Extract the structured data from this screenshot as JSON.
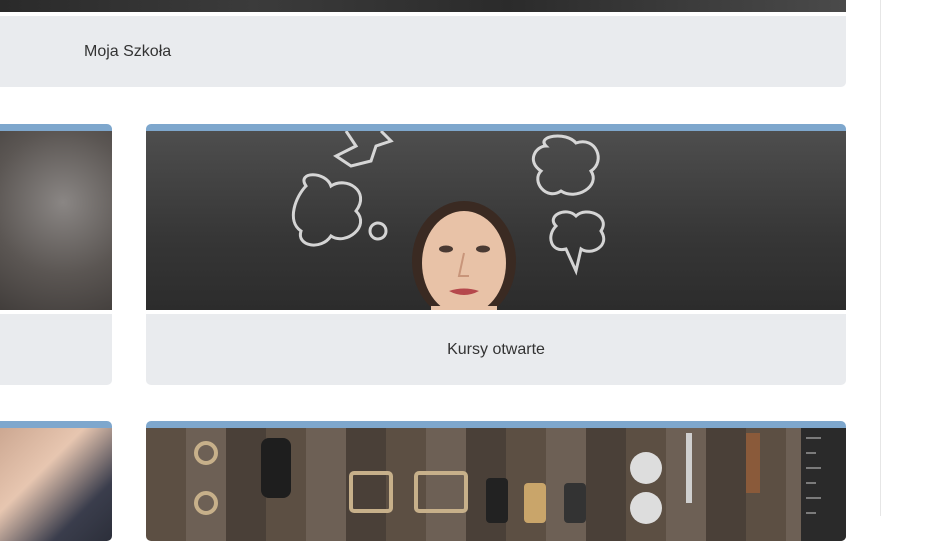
{
  "cards": [
    {
      "id": "top",
      "label": "Moja Szkoła"
    },
    {
      "id": "open",
      "label": "Kursy otwarte"
    }
  ],
  "colors": {
    "accent": "#7ea7cd",
    "caption_bg": "#e9ebee",
    "caption_text": "#333333"
  }
}
